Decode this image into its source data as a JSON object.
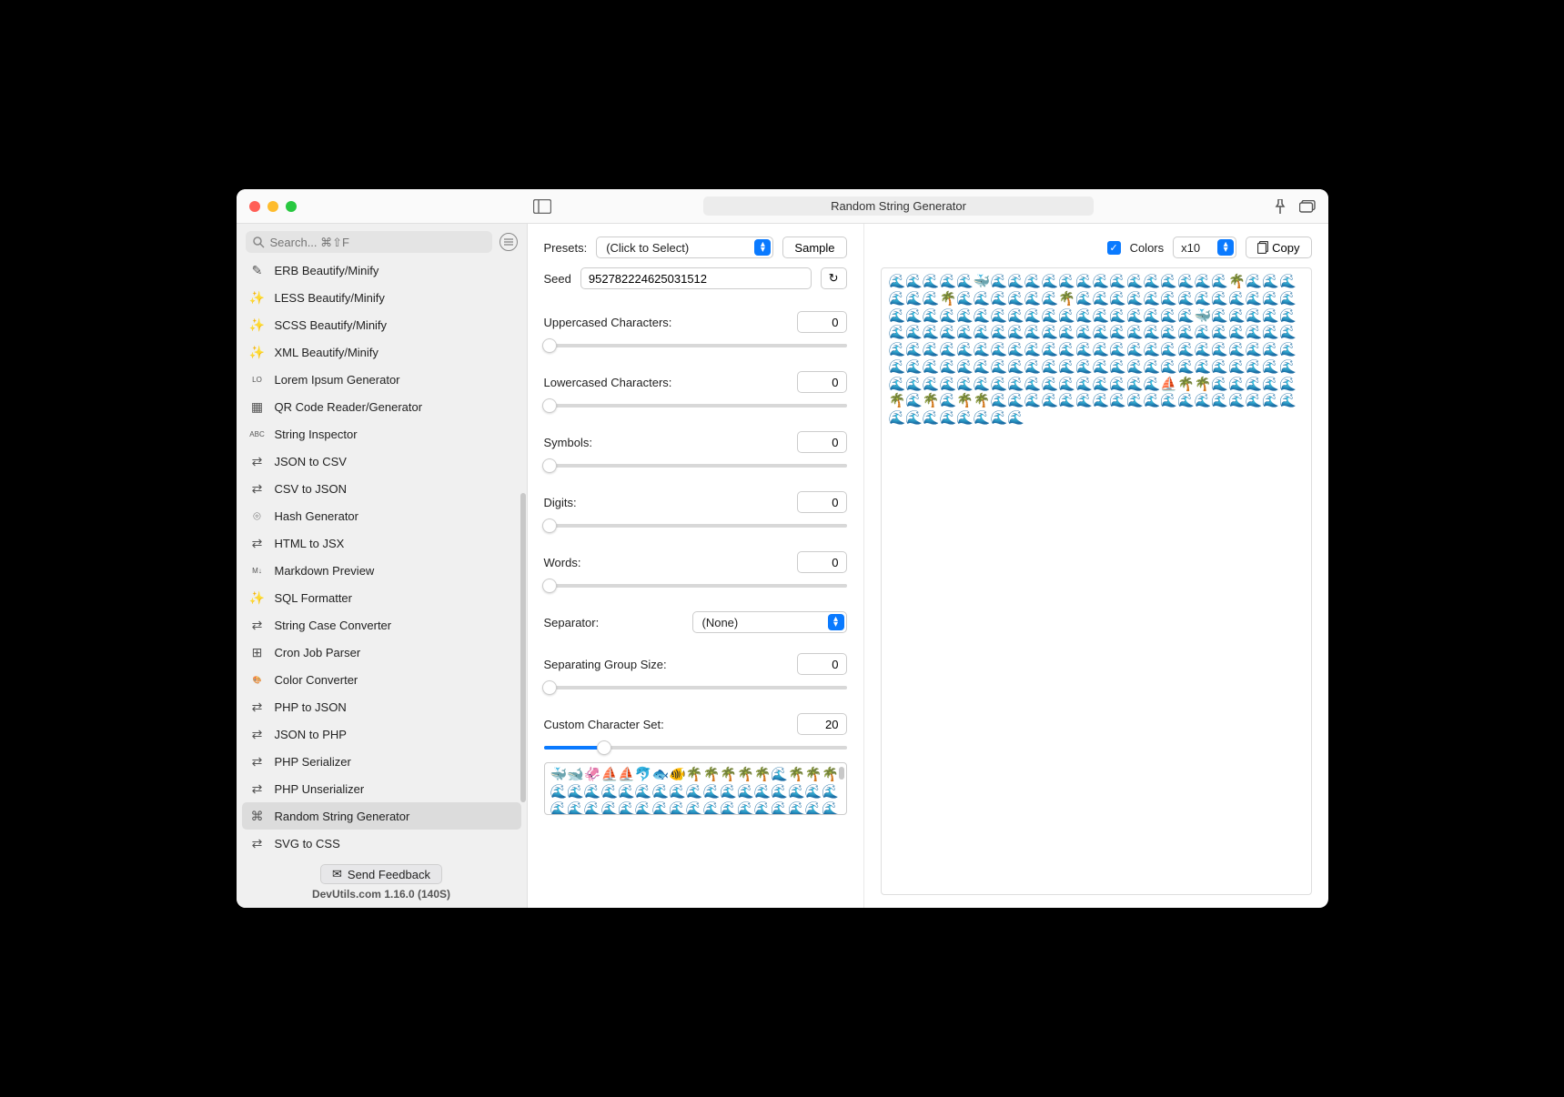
{
  "window": {
    "title": "Random String Generator"
  },
  "search": {
    "placeholder": "Search... ⌘⇧F"
  },
  "sidebar": {
    "items": [
      {
        "icon": "✎",
        "label": "ERB Beautify/Minify"
      },
      {
        "icon": "✨",
        "label": "LESS Beautify/Minify"
      },
      {
        "icon": "✨",
        "label": "SCSS Beautify/Minify"
      },
      {
        "icon": "✨",
        "label": "XML Beautify/Minify"
      },
      {
        "icon": "LO",
        "label": "Lorem Ipsum Generator"
      },
      {
        "icon": "▦",
        "label": "QR Code Reader/Generator"
      },
      {
        "icon": "ABC",
        "label": "String Inspector"
      },
      {
        "icon": "⇄",
        "label": "JSON to CSV"
      },
      {
        "icon": "⇄",
        "label": "CSV to JSON"
      },
      {
        "icon": "⌾",
        "label": "Hash Generator"
      },
      {
        "icon": "⇄",
        "label": "HTML to JSX"
      },
      {
        "icon": "M↓",
        "label": "Markdown Preview"
      },
      {
        "icon": "✨",
        "label": "SQL Formatter"
      },
      {
        "icon": "⇄",
        "label": "String Case Converter"
      },
      {
        "icon": "⊞",
        "label": "Cron Job Parser"
      },
      {
        "icon": "🎨",
        "label": "Color Converter"
      },
      {
        "icon": "⇄",
        "label": "PHP to JSON"
      },
      {
        "icon": "⇄",
        "label": "JSON to PHP"
      },
      {
        "icon": "⇄",
        "label": "PHP Serializer"
      },
      {
        "icon": "⇄",
        "label": "PHP Unserializer"
      },
      {
        "icon": "⌘",
        "label": "Random String Generator",
        "selected": true
      },
      {
        "icon": "⇄",
        "label": "SVG to CSS"
      }
    ],
    "feedback_label": "Send Feedback",
    "version": "DevUtils.com 1.16.0 (140S)"
  },
  "controls": {
    "presets_label": "Presets:",
    "presets_value": "(Click to Select)",
    "sample_label": "Sample",
    "seed_label": "Seed",
    "seed_value": "952782224625031512",
    "uppercased_label": "Uppercased Characters:",
    "uppercased_value": "0",
    "lowercased_label": "Lowercased Characters:",
    "lowercased_value": "0",
    "symbols_label": "Symbols:",
    "symbols_value": "0",
    "digits_label": "Digits:",
    "digits_value": "0",
    "words_label": "Words:",
    "words_value": "0",
    "separator_label": "Separator:",
    "separator_value": "(None)",
    "groupsize_label": "Separating Group Size:",
    "groupsize_value": "0",
    "customset_label": "Custom Character Set:",
    "customset_value": "20",
    "customset_text": "🐳🐋🦑⛵⛵🐬🐟🐠🌴🌴🌴🌴🌴🌊🌴🌴🌴🌊🌊🌊🌊🌊🌊🌊🌊🌊🌊🌊🌊🌊🌊🌊🌊🌊🌊🌊🌊🌊🌊🌊🌊🌊🌊🌊🌊🌊🌊🌊🌊🌊🌊🌊🌊🌊🌊🌊🌊🌊🌊🌊"
  },
  "output": {
    "colors_label": "Colors",
    "multiplier": "x10",
    "copy_label": "Copy",
    "text": "🌊🌊🌊🌊🌊🐳🌊🌊🌊🌊🌊🌊🌊🌊🌊🌊🌊🌊🌊🌊🌴🌊🌊🌊🌊🌊🌊🌴🌊🌊🌊🌊🌊🌊🌴🌊🌊🌊🌊🌊🌊🌊🌊🌊🌊🌊🌊🌊🌊🌊🌊🌊🌊🌊🌊🌊🌊🌊🌊🌊🌊🌊🌊🌊🌊🌊🐳🌊🌊🌊🌊🌊🌊🌊🌊🌊🌊🌊🌊🌊🌊🌊🌊🌊🌊🌊🌊🌊🌊🌊🌊🌊🌊🌊🌊🌊🌊🌊🌊🌊🌊🌊🌊🌊🌊🌊🌊🌊🌊🌊🌊🌊🌊🌊🌊🌊🌊🌊🌊🌊🌊🌊🌊🌊🌊🌊🌊🌊🌊🌊🌊🌊🌊🌊🌊🌊🌊🌊🌊🌊🌊🌊🌊🌊🌊🌊🌊🌊🌊🌊🌊🌊🌊🌊🌊🌊🌊🌊🌊🌊⛵🌴🌴🌊🌊🌊🌊🌊🌴🌊🌴🌊🌴🌴🌊🌊🌊🌊🌊🌊🌊🌊🌊🌊🌊🌊🌊🌊🌊🌊🌊🌊🌊🌊🌊🌊🌊🌊🌊🌊"
  }
}
